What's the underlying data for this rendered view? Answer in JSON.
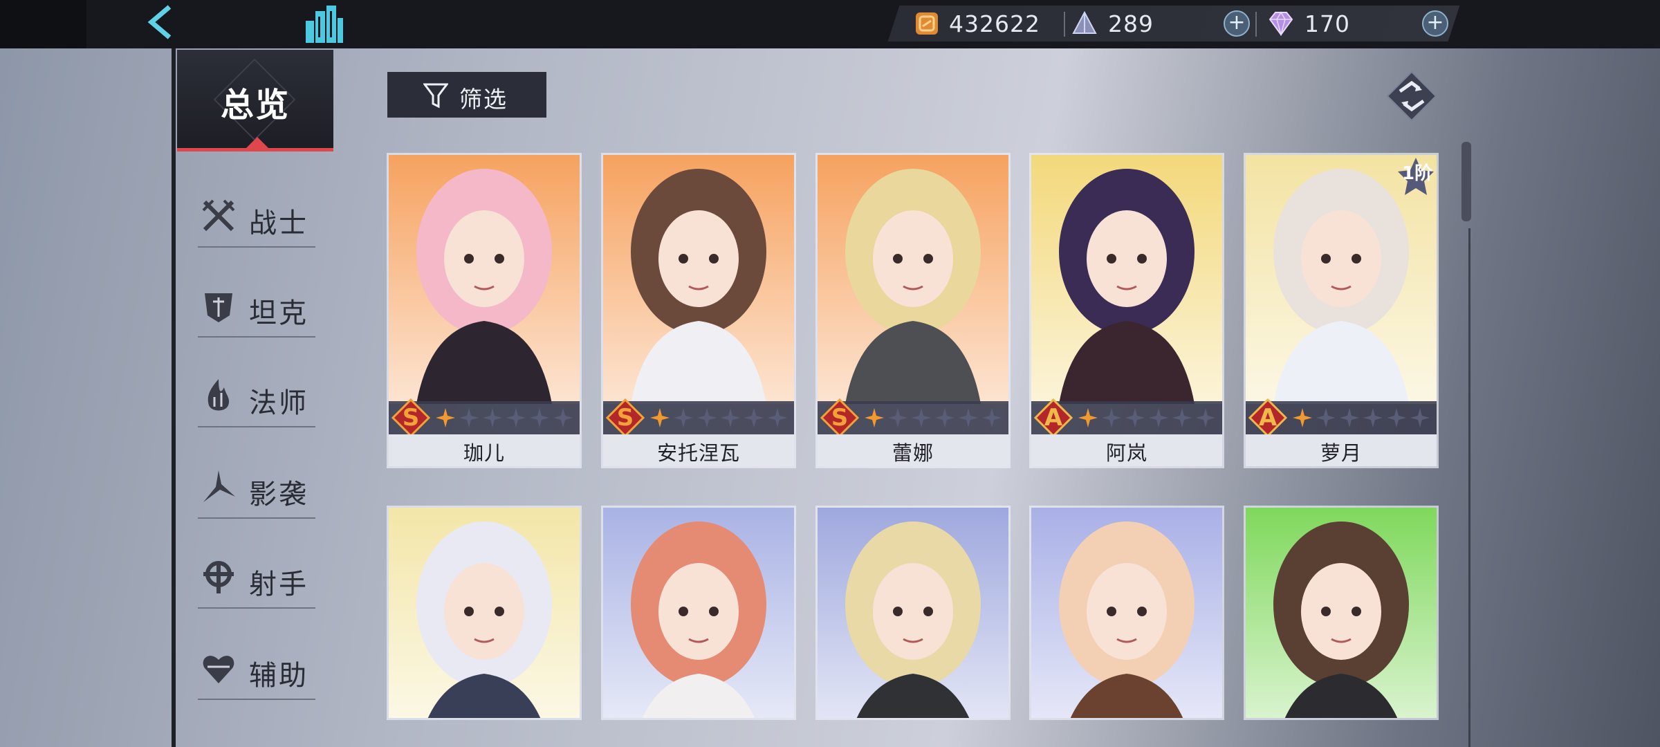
{
  "topbar": {
    "resources": {
      "gold": "432622",
      "stamina": "289",
      "diamond": "170"
    }
  },
  "sidebar": {
    "overview_label": "总览",
    "items": [
      {
        "label": "战士"
      },
      {
        "label": "坦克"
      },
      {
        "label": "法师"
      },
      {
        "label": "影袭"
      },
      {
        "label": "射手"
      },
      {
        "label": "辅助"
      }
    ]
  },
  "filter": {
    "label": "筛选"
  },
  "characters": [
    {
      "name": "珈儿",
      "rank": "S",
      "stars": 1,
      "bg": "#f6a25f"
    },
    {
      "name": "安托涅瓦",
      "rank": "S",
      "stars": 1,
      "bg": "#f6a25f"
    },
    {
      "name": "蕾娜",
      "rank": "S",
      "stars": 1,
      "bg": "#f6a25f"
    },
    {
      "name": "阿岚",
      "rank": "A",
      "stars": 1,
      "bg": "#f3d87a"
    },
    {
      "name": "萝月",
      "rank": "A",
      "stars": 1,
      "bg": "#f3e3a2",
      "tier": "1阶"
    },
    {
      "name": "",
      "bg": "#f3e6a8"
    },
    {
      "name": "",
      "bg": "#a9b3e4"
    },
    {
      "name": "",
      "bg": "#9fa8de"
    },
    {
      "name": "",
      "bg": "#a9b0e6"
    },
    {
      "name": "",
      "bg": "#7fd85c"
    }
  ],
  "colors": {
    "accent_red": "#e0474c",
    "rank_s": "#f2a236",
    "rank_a": "#f0b84a"
  }
}
